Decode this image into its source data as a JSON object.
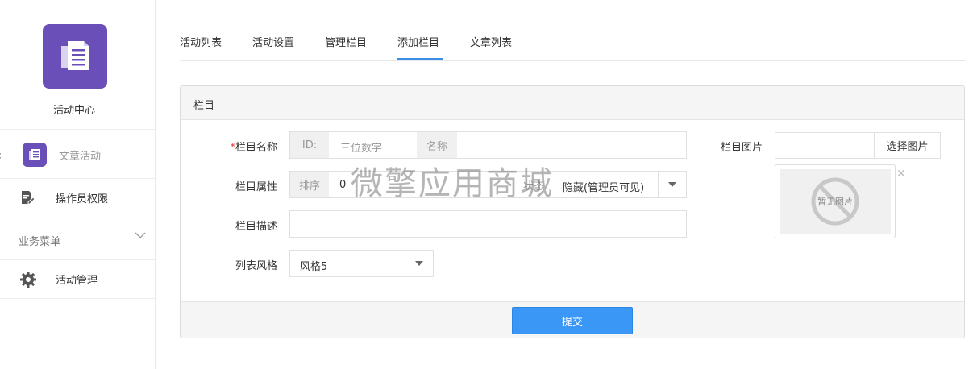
{
  "sidebar": {
    "app_name": "活动中心",
    "sub_app_label": "文章活动",
    "operator_label": "操作员权限",
    "biz_menu_label": "业务菜单",
    "manage_label": "活动管理"
  },
  "tabs": [
    {
      "label": "活动列表",
      "active": false
    },
    {
      "label": "活动设置",
      "active": false
    },
    {
      "label": "管理栏目",
      "active": false
    },
    {
      "label": "添加栏目",
      "active": true
    },
    {
      "label": "文章列表",
      "active": false
    }
  ],
  "panel": {
    "title": "栏目",
    "submit_label": "提交"
  },
  "form": {
    "name_label": "栏目名称",
    "name_required_mark": "*",
    "id_addon": "ID:",
    "id_placeholder": "三位数字",
    "name_addon": "名称",
    "attr_label": "栏目属性",
    "sort_addon": "排序",
    "sort_value": "0",
    "status_addon": "状态",
    "status_value": "隐藏(管理员可见)",
    "desc_label": "栏目描述",
    "style_label": "列表风格",
    "style_value": "风格5",
    "pic_label": "栏目图片",
    "pic_button": "选择图片",
    "pic_placeholder_text": "暂无图片"
  },
  "watermark": "微擎应用商城",
  "colors": {
    "brand": "#6a4fb8",
    "accent": "#3a97f5"
  }
}
